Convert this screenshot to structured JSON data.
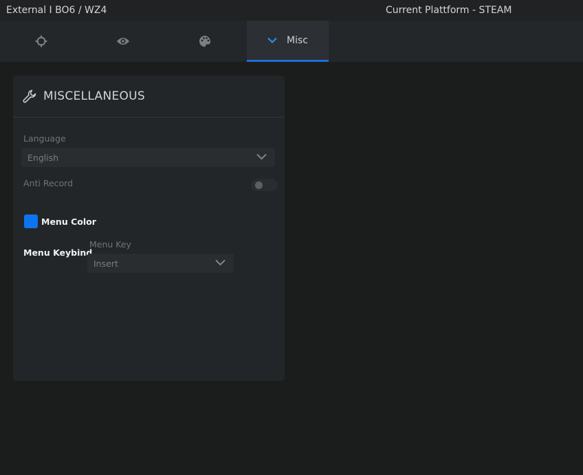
{
  "titlebar": {
    "app_title": "External I BO6 / WZ4",
    "platform": "Current Plattform - STEAM"
  },
  "tabs": [
    {
      "icon": "crosshair-icon",
      "label": ""
    },
    {
      "icon": "eye-icon",
      "label": ""
    },
    {
      "icon": "palette-icon",
      "label": ""
    },
    {
      "icon": "chevron-down-icon",
      "label": "Misc",
      "active": true
    }
  ],
  "panel": {
    "icon": "wrench-icon",
    "title": "MISCELLANEOUS",
    "language": {
      "label": "Language",
      "value": "English"
    },
    "anti_record": {
      "label": "Anti Record",
      "enabled": false
    },
    "menu_color": {
      "label": "Menu Color",
      "color": "#0d74f0"
    },
    "menu_keybind": {
      "label": "Menu Keybind",
      "key_label": "Menu Key",
      "value": "Insert"
    }
  },
  "colors": {
    "accent": "#1c6fd8",
    "background": "#1b1d1d",
    "panel": "#232628"
  }
}
